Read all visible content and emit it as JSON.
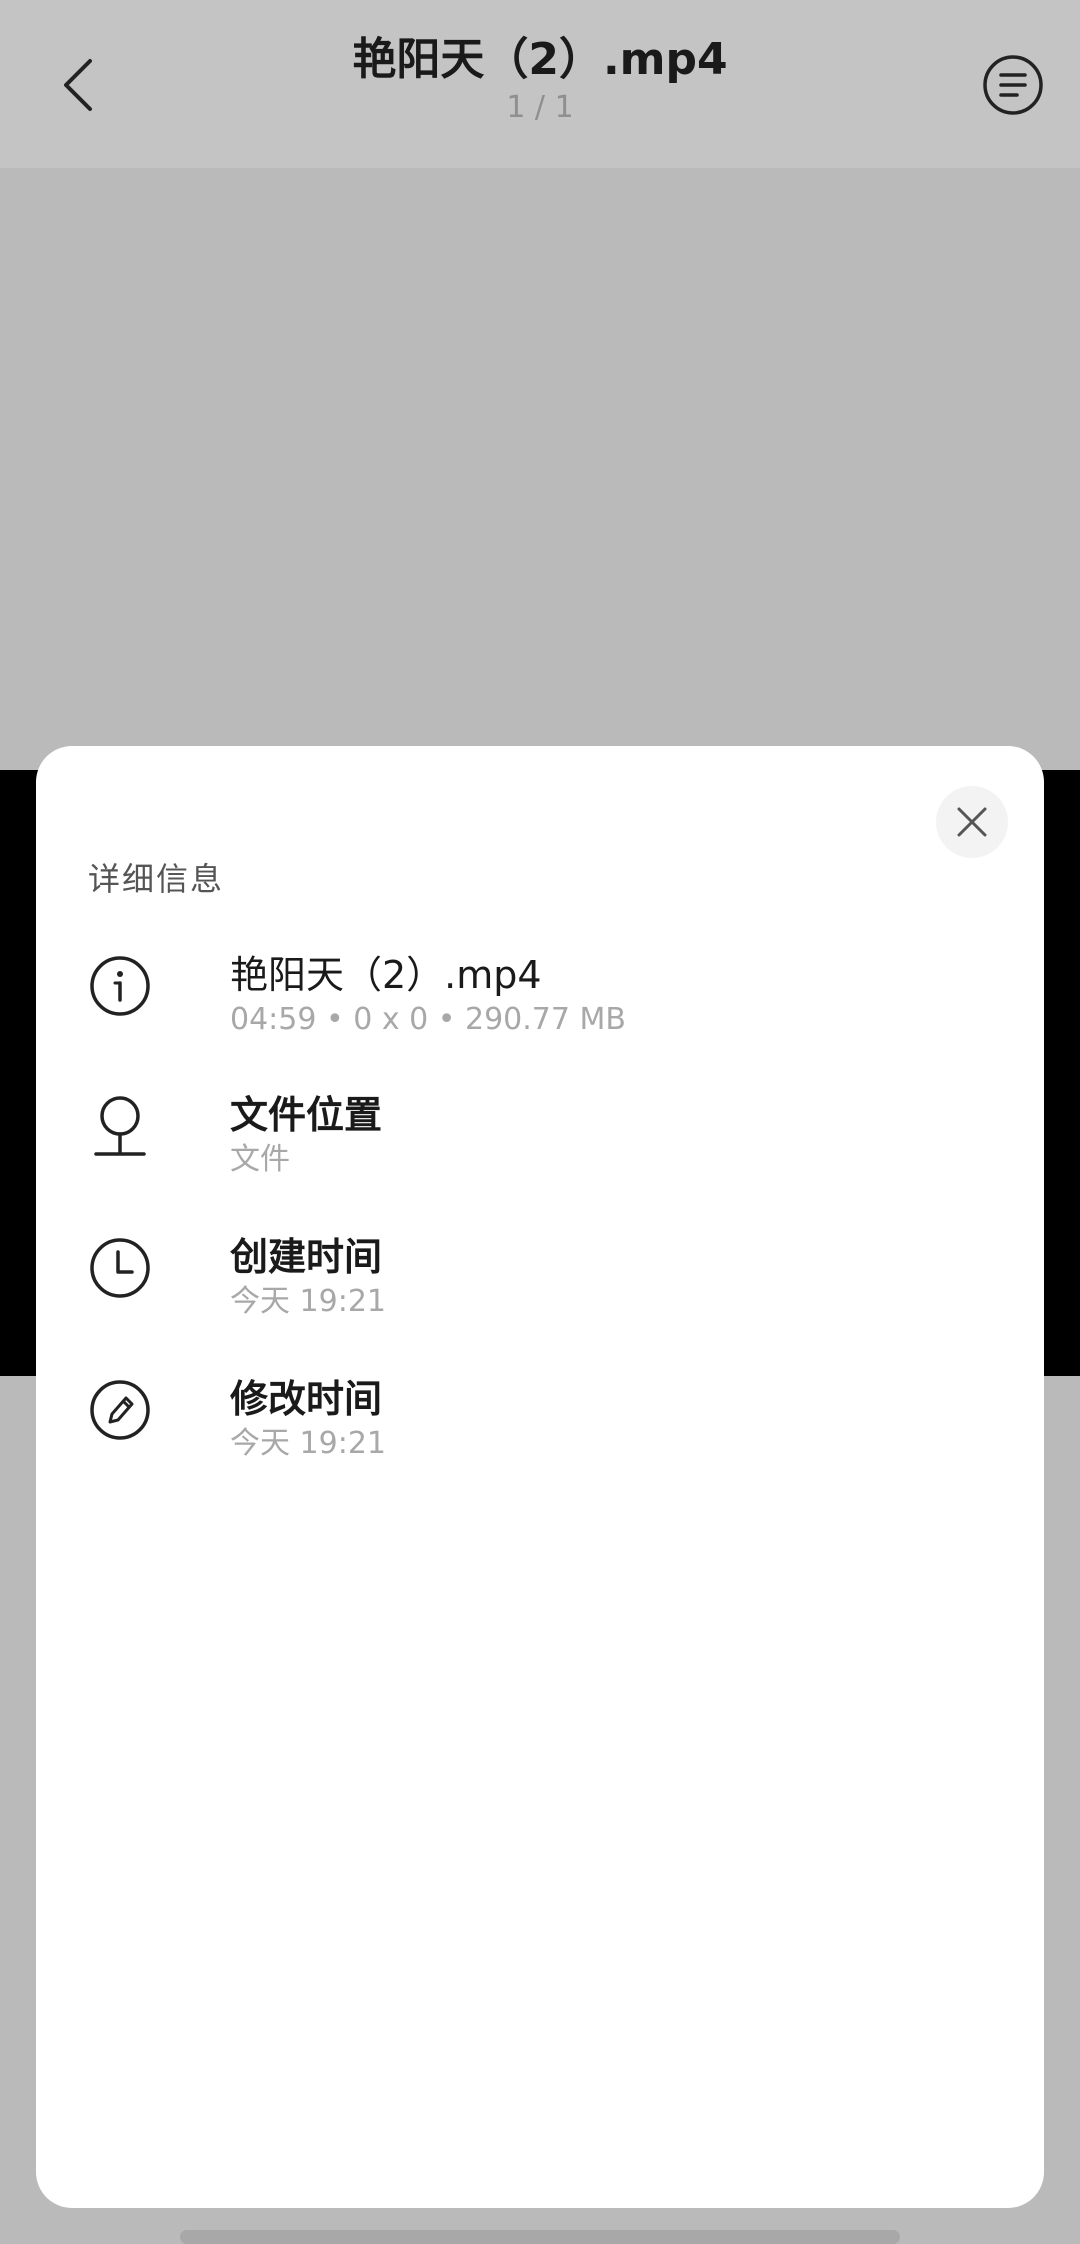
{
  "header": {
    "title": "艳阳天（2）.mp4",
    "counter": "1 / 1",
    "back_icon": "chevron-left-icon",
    "menu_icon": "list-menu-icon"
  },
  "sheet": {
    "title": "详细信息",
    "close_icon": "close-icon",
    "rows": [
      {
        "icon": "info-icon",
        "main": "艳阳天（2）.mp4",
        "sub": "04:59 • 0 x 0 • 290.77 MB"
      },
      {
        "icon": "location-pin-icon",
        "main": "文件位置",
        "sub": "文件"
      },
      {
        "icon": "clock-icon",
        "main": "创建时间",
        "sub": "今天 19:21"
      },
      {
        "icon": "pencil-icon",
        "main": "修改时间",
        "sub": "今天 19:21"
      }
    ]
  },
  "colors": {
    "topbar_bg": "#c4c4c4",
    "video_bg": "#bababa",
    "sheet_bg": "#ffffff",
    "primary_text": "#1a1a1a",
    "secondary_text": "#a8a8a8"
  }
}
